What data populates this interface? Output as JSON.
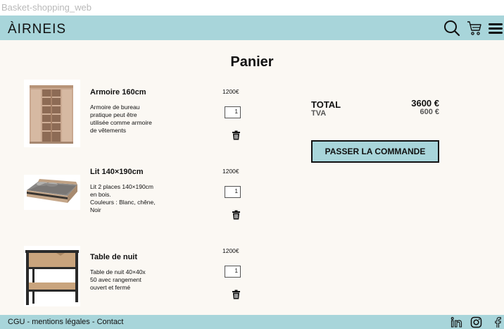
{
  "frame": {
    "label": "Basket-shopping_web"
  },
  "header": {
    "logo": "ÀIRNEIS",
    "icons": [
      "search-icon",
      "cart-icon",
      "menu-icon"
    ]
  },
  "page": {
    "title": "Panier"
  },
  "cart": {
    "items": [
      {
        "name": "Armoire 160cm",
        "description": "Armoire de bureau\npratique peut être\nutilisée comme armoire\nde vêtements",
        "price": "1200€",
        "quantity": "1"
      },
      {
        "name": "Lit 140×190cm",
        "description": "Lit 2 places 140×190cm\nen bois.\nCouleurs : Blanc, chêne,\nNoir",
        "price": "1200€",
        "quantity": "1"
      },
      {
        "name": "Table de nuit",
        "description": "Table de nuit 40×40x\n50 avec rangement\nouvert et fermé",
        "price": "1200€",
        "quantity": "1"
      }
    ]
  },
  "summary": {
    "total_label": "TOTAL",
    "total_value": "3600 €",
    "tva_label": "TVA",
    "tva_value": "600 €",
    "checkout_label": "PASSER LA COMMANDE"
  },
  "footer": {
    "cgu": "CGU",
    "sep1": " - ",
    "legal": "mentions légales",
    "sep2": " - ",
    "contact": "Contact",
    "icons": [
      "linkedin-icon",
      "instagram-icon",
      "facebook-icon"
    ]
  },
  "colors": {
    "accent": "#a8d5da",
    "background": "#fbf8f3",
    "text": "#111111"
  }
}
